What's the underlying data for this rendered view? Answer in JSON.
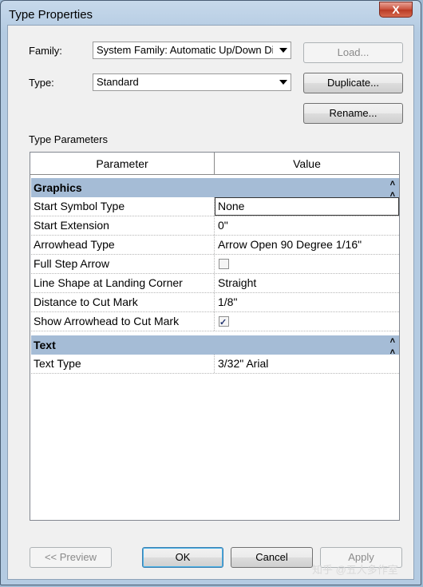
{
  "window": {
    "title": "Type Properties",
    "close_glyph": "X"
  },
  "family": {
    "label": "Family:",
    "value": "System Family: Automatic Up/Down Di"
  },
  "type": {
    "label": "Type:",
    "value": "Standard"
  },
  "buttons": {
    "load": "Load...",
    "duplicate": "Duplicate...",
    "rename": "Rename..."
  },
  "section_title": "Type Parameters",
  "table": {
    "headers": [
      "Parameter",
      "Value"
    ],
    "groups": [
      {
        "name": "Graphics",
        "rows": [
          {
            "param": "Start Symbol Type",
            "value": "None"
          },
          {
            "param": "Start Extension",
            "value": "0\""
          },
          {
            "param": "Arrowhead Type",
            "value": "Arrow Open 90 Degree 1/16\""
          },
          {
            "param": "Full Step Arrow",
            "checked": false
          },
          {
            "param": "Line Shape at Landing Corner",
            "value": "Straight"
          },
          {
            "param": "Distance to Cut Mark",
            "value": "1/8\""
          },
          {
            "param": "Show Arrowhead to Cut Mark",
            "checked": true
          }
        ]
      },
      {
        "name": "Text",
        "rows": [
          {
            "param": "Text Type",
            "value": "3/32\" Arial"
          }
        ]
      }
    ],
    "collapse_glyph": "^"
  },
  "footer": {
    "preview": "<< Preview",
    "ok": "OK",
    "cancel": "Cancel",
    "apply": "Apply"
  },
  "watermark": "知乎 @五人多作室"
}
